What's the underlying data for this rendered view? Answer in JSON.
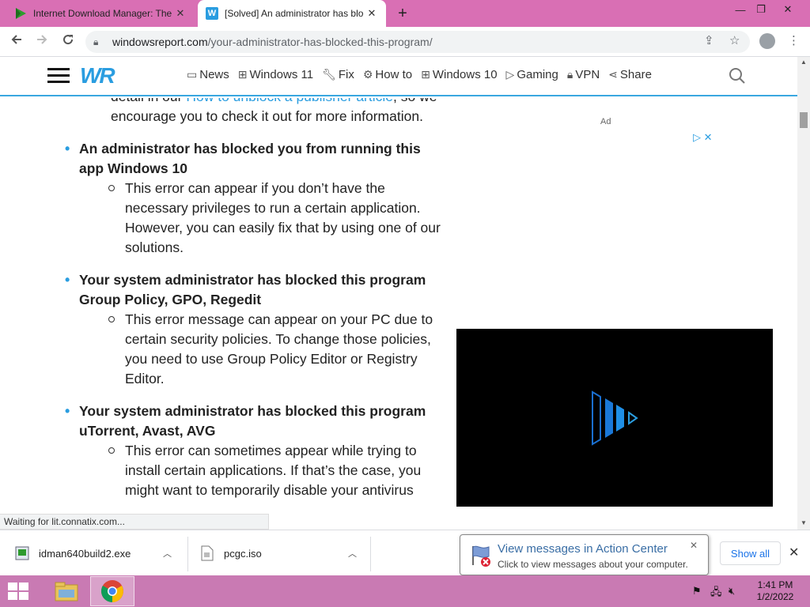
{
  "browser": {
    "tabs": [
      {
        "title": "Internet Download Manager: The",
        "active": false
      },
      {
        "title": "[Solved] An administrator has blo",
        "active": true
      }
    ],
    "new_tab": "+",
    "close_glyph": "✕",
    "window_controls": {
      "minimize": "—",
      "restore": "❐",
      "close": "✕"
    },
    "url_domain": "windowsreport.com",
    "url_path": "/your-administrator-has-blocked-this-program/"
  },
  "site": {
    "logo": "WR",
    "nav": [
      {
        "label": "News",
        "icon": "news-icon"
      },
      {
        "label": "Windows 11",
        "icon": "windows-icon"
      },
      {
        "label": "Fix",
        "icon": "wrench-icon"
      },
      {
        "label": "How to",
        "icon": "gear-icon"
      },
      {
        "label": "Windows 10",
        "icon": "windows-icon"
      },
      {
        "label": "Gaming",
        "icon": "play-icon"
      },
      {
        "label": "VPN",
        "icon": "lock-icon"
      },
      {
        "label": "Share",
        "icon": "share-icon"
      }
    ]
  },
  "article": {
    "intro_before_link": "detail in our ",
    "intro_link": "How to unblock a publisher article",
    "intro_after_link": ", so we encourage you to check it out for more information.",
    "items": [
      {
        "heading": "An administrator has blocked you from running this app Windows 10",
        "text": "This error can appear if you don’t have the necessary privileges to run a certain application. However, you can easily fix that by using one of our solutions."
      },
      {
        "heading": "Your system administrator has blocked this program Group Policy, GPO, Regedit",
        "text": "This error message can appear on your PC due to certain security policies. To change those policies, you need to use Group Policy Editor or Registry Editor."
      },
      {
        "heading": "Your system administrator has blocked this program uTorrent, Avast, AVG",
        "text": "This error can sometimes appear while trying to install certain applications. If that’s the case, you might want to temporarily disable your antivirus"
      }
    ]
  },
  "ad": {
    "label": "Ad"
  },
  "status_text": "Waiting for lit.connatix.com...",
  "downloads": {
    "files": [
      {
        "name": "idman640build2.exe"
      },
      {
        "name": "pcgc.iso"
      }
    ],
    "show_all": "Show all"
  },
  "notification": {
    "title": "View messages in Action Center",
    "subtitle": "Click to view messages about your computer."
  },
  "taskbar": {
    "time": "1:41 PM",
    "date": "1/2/2022"
  }
}
